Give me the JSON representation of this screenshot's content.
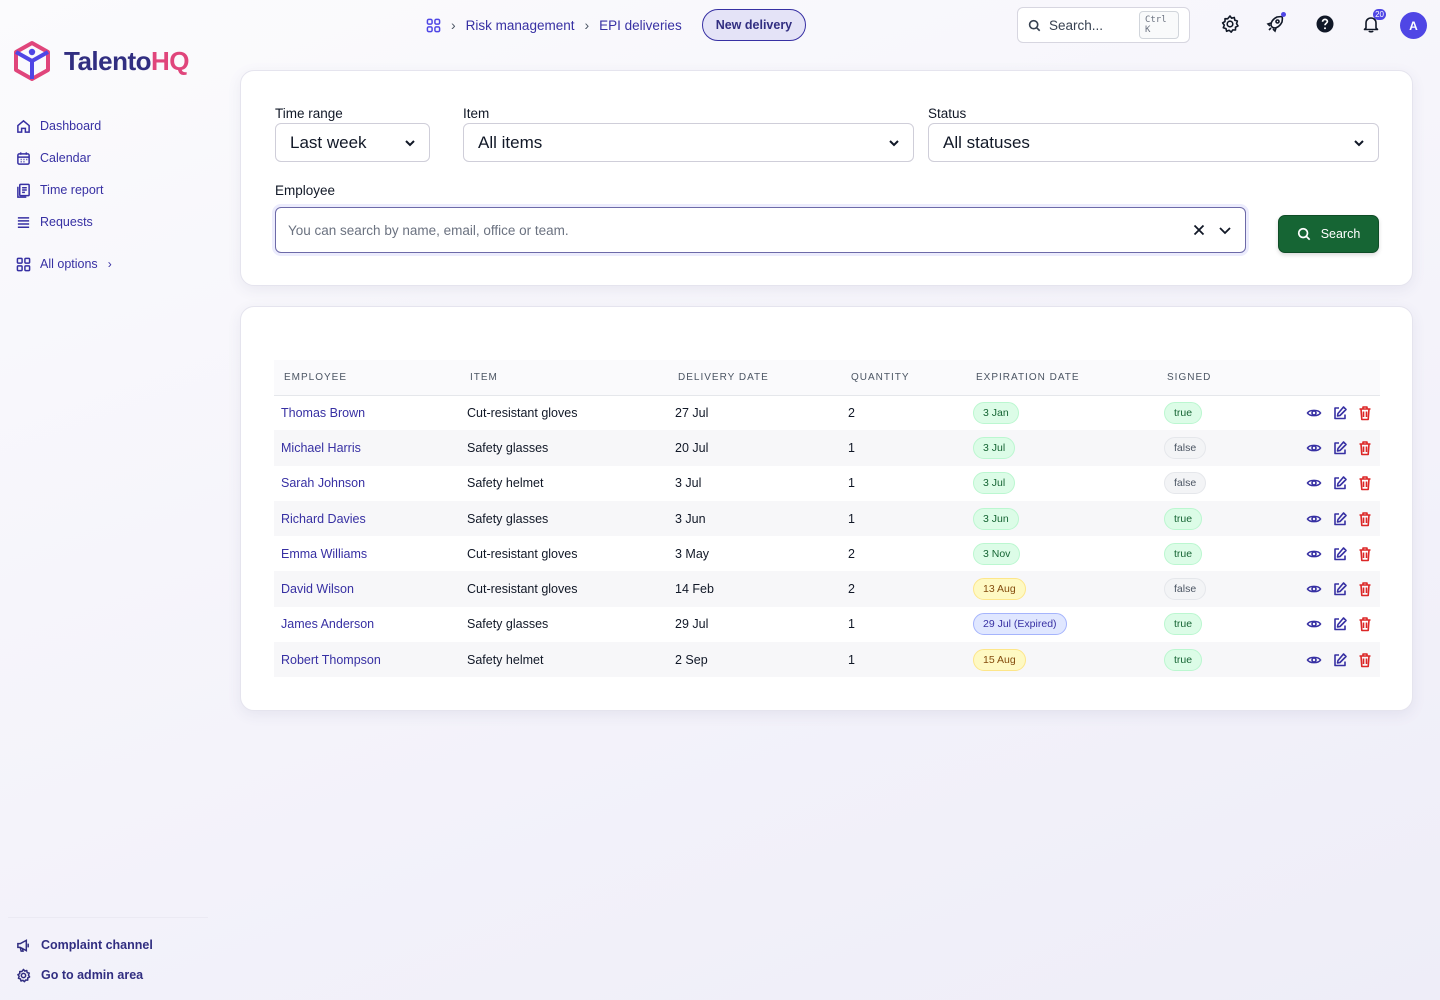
{
  "app": {
    "logo_main": "Talento",
    "logo_accent": "HQ"
  },
  "sidebar": {
    "items": [
      {
        "label": "Dashboard",
        "icon": "home-icon"
      },
      {
        "label": "Calendar",
        "icon": "calendar-icon"
      },
      {
        "label": "Time report",
        "icon": "report-icon"
      },
      {
        "label": "Requests",
        "icon": "list-icon"
      }
    ],
    "all_options": "All options",
    "bottom": [
      {
        "label": "Complaint channel",
        "icon": "megaphone-icon"
      },
      {
        "label": "Go to admin area",
        "icon": "gear-icon"
      }
    ]
  },
  "header": {
    "breadcrumb": [
      "Risk management",
      "EPI deliveries"
    ],
    "new_delivery": "New delivery",
    "search_placeholder": "Search...",
    "search_shortcut": "Ctrl K",
    "notifications_count": "20",
    "avatar_initial": "A",
    "accent_color": "#4f46e5"
  },
  "filters": {
    "time_range": {
      "label": "Time range",
      "value": "Last week"
    },
    "item": {
      "label": "Item",
      "value": "All items"
    },
    "status": {
      "label": "Status",
      "value": "All statuses"
    },
    "employee": {
      "label": "Employee",
      "placeholder": "You can search by name, email, office or team."
    },
    "search_button": "Search",
    "search_button_color": "#166534"
  },
  "table": {
    "headers": [
      "EMPLOYEE",
      "ITEM",
      "DELIVERY DATE",
      "QUANTITY",
      "EXPIRATION DATE",
      "SIGNED"
    ],
    "rows": [
      {
        "employee": "Thomas Brown",
        "item": "Cut-resistant gloves",
        "delivery": "27 Jul",
        "qty": "2",
        "expiration": "3 Jan",
        "exp_status": "green",
        "signed": "true"
      },
      {
        "employee": "Michael Harris",
        "item": "Safety glasses",
        "delivery": "20 Jul",
        "qty": "1",
        "expiration": "3 Jul",
        "exp_status": "green",
        "signed": "false"
      },
      {
        "employee": "Sarah Johnson",
        "item": "Safety helmet",
        "delivery": "3 Jul",
        "qty": "1",
        "expiration": "3 Jul",
        "exp_status": "green",
        "signed": "false"
      },
      {
        "employee": "Richard Davies",
        "item": "Safety glasses",
        "delivery": "3 Jun",
        "qty": "1",
        "expiration": "3 Jun",
        "exp_status": "green",
        "signed": "true"
      },
      {
        "employee": "Emma Williams",
        "item": "Cut-resistant gloves",
        "delivery": "3 May",
        "qty": "2",
        "expiration": "3 Nov",
        "exp_status": "green",
        "signed": "true"
      },
      {
        "employee": "David Wilson",
        "item": "Cut-resistant gloves",
        "delivery": "14 Feb",
        "qty": "2",
        "expiration": "13 Aug",
        "exp_status": "yellow",
        "signed": "false"
      },
      {
        "employee": "James Anderson",
        "item": "Safety glasses",
        "delivery": "29 Jul",
        "qty": "1",
        "expiration": "29 Jul (Expired)",
        "exp_status": "indigo",
        "signed": "true"
      },
      {
        "employee": "Robert Thompson",
        "item": "Safety helmet",
        "delivery": "2 Sep",
        "qty": "1",
        "expiration": "15 Aug",
        "exp_status": "yellow",
        "signed": "true"
      }
    ]
  }
}
